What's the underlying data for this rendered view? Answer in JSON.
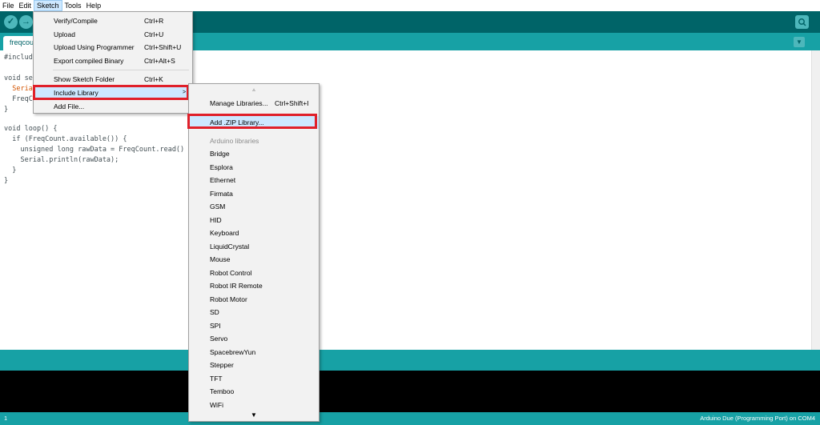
{
  "menubar": {
    "items": [
      "File",
      "Edit",
      "Sketch",
      "Tools",
      "Help"
    ],
    "active": "Sketch"
  },
  "toolbar": {
    "verify_icon": "check-icon",
    "upload_icon": "arrow-right-icon",
    "serial_monitor_icon": "magnifier-icon"
  },
  "tabs": {
    "file_tab": "freqcou",
    "tab_menu_icon": "chevron-down-icon"
  },
  "code": {
    "lines": [
      "#includ",
      "",
      "void se",
      "  Seria",
      "  FreqC",
      "}",
      "",
      "void loop() {",
      "  if (FreqCount.available()) {",
      "    unsigned long rawData = FreqCount.read()",
      "    Serial.println(rawData);",
      "  }",
      "}"
    ]
  },
  "sketch_menu": {
    "items": [
      {
        "label": "Verify/Compile",
        "shortcut": "Ctrl+R"
      },
      {
        "label": "Upload",
        "shortcut": "Ctrl+U"
      },
      {
        "label": "Upload Using Programmer",
        "shortcut": "Ctrl+Shift+U"
      },
      {
        "label": "Export compiled Binary",
        "shortcut": "Ctrl+Alt+S"
      },
      {
        "label": "Show Sketch Folder",
        "shortcut": "Ctrl+K"
      },
      {
        "label": "Include Library",
        "shortcut": "",
        "submenu_arrow": ">"
      },
      {
        "label": "Add File...",
        "shortcut": ""
      }
    ]
  },
  "library_menu": {
    "scroll_up": "▵",
    "manage": {
      "label": "Manage Libraries...",
      "shortcut": "Ctrl+Shift+I"
    },
    "add_zip": "Add .ZIP Library...",
    "section_header": "Arduino libraries",
    "libraries": [
      "Bridge",
      "Esplora",
      "Ethernet",
      "Firmata",
      "GSM",
      "HID",
      "Keyboard",
      "LiquidCrystal",
      "Mouse",
      "Robot Control",
      "Robot IR Remote",
      "Robot Motor",
      "SD",
      "SPI",
      "Servo",
      "SpacebrewYun",
      "Stepper",
      "TFT",
      "Temboo",
      "WiFi"
    ],
    "scroll_down": "▼"
  },
  "footer": {
    "line_number": "1",
    "board": "Arduino Due (Programming Port) on COM4"
  },
  "colors": {
    "toolbar": "#006468",
    "tab_row": "#17a1a5",
    "highlight_box": "#e0202a",
    "menu_hover": "#cde8ff"
  }
}
